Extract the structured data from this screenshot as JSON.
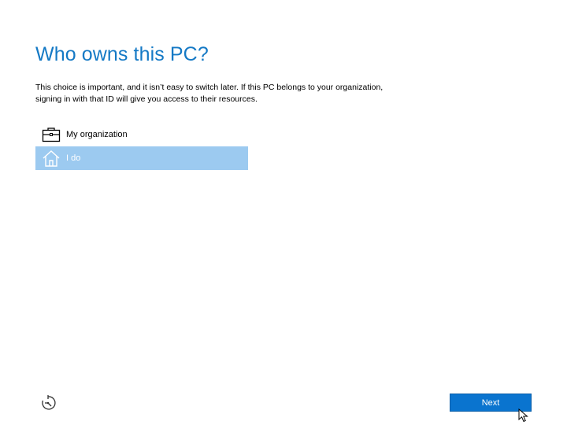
{
  "title": "Who owns this PC?",
  "description": "This choice is important, and it isn’t easy to switch later. If this PC belongs to your organization, signing in with that ID will give you access to their resources.",
  "options": [
    {
      "label": "My organization",
      "icon": "briefcase-icon",
      "selected": false
    },
    {
      "label": "I do",
      "icon": "home-icon",
      "selected": true
    }
  ],
  "footer": {
    "ease_of_access_icon": "ease-of-access-icon",
    "next_label": "Next"
  },
  "colors": {
    "title": "#1479c5",
    "selected_bg": "#9ccaf0",
    "button_bg": "#0a74cf"
  }
}
